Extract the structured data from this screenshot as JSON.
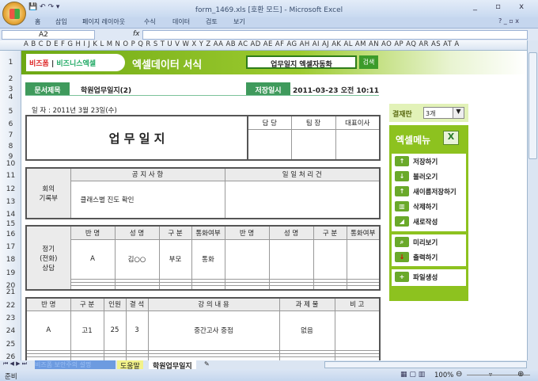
{
  "window": {
    "title": "form_1469.xls  [호환 모드] - Microsoft Excel",
    "controls": "_ ▫ x"
  },
  "ribbon": {
    "tabs": [
      "홈",
      "삽입",
      "페이지 레이아웃",
      "수식",
      "데이터",
      "검토",
      "보기"
    ]
  },
  "formula_bar": {
    "name_box": "A2",
    "fx": "fx",
    "value": ""
  },
  "columns": "A B C D E F G H I J K L M N O P Q R S T U V W X Y Z AA AB AC AD AE AF AG AH AI AJ AK AL AM AN AO AP AQ AR AS AT A",
  "rows": [
    "1",
    "2",
    "3",
    "4",
    "5",
    "6",
    "7",
    "8",
    "9",
    "10",
    "11",
    "12",
    "13",
    "14",
    "15",
    "16",
    "17",
    "18",
    "19",
    "20",
    "21",
    "22",
    "23",
    "24",
    "25",
    "26"
  ],
  "banner": {
    "logo1": "비즈폼",
    "logo2": "비즈니스엑셀",
    "title": "엑셀데이터 서식",
    "search_value": "업무일지 엑셀자동화",
    "search_button": "검색"
  },
  "header": {
    "doc_title_label": "문서제목",
    "doc_title": "학원업무일지(2)",
    "saved_label": "저장일시",
    "saved_at": "2011-03-23  오전 10:11"
  },
  "date_line": "일 자 :   2011년 3월 23일(수)",
  "form": {
    "title": "업 무 일 지",
    "approvals": [
      "담 당",
      "팀 장",
      "대표이사"
    ],
    "meeting": {
      "label": "회의\n기록부",
      "notice_header": "공 지 사 항",
      "daily_header": "일 일 처 리 건",
      "notice": "클래스별 진도 확인",
      "daily": ""
    },
    "consult": {
      "label": "정기\n(전화)\n상담",
      "headers": [
        "반 명",
        "성 명",
        "구 분",
        "통화여부",
        "반 명",
        "성 명",
        "구 분",
        "통화여부"
      ],
      "rows": [
        [
          "A",
          "김○○",
          "부모",
          "통화",
          "",
          "",
          "",
          ""
        ],
        [
          "",
          "",
          "",
          "",
          "",
          "",
          "",
          ""
        ],
        [
          "",
          "",
          "",
          "",
          "",
          "",
          "",
          ""
        ],
        [
          "",
          "",
          "",
          "",
          "",
          "",
          "",
          ""
        ]
      ]
    },
    "lecture": {
      "headers": [
        "반 명",
        "구 분",
        "인원",
        "결 석",
        "강 의 내 용",
        "과 제 물",
        "비 고"
      ],
      "rows": [
        [
          "A",
          "고1",
          "25",
          "3",
          "중간고사 중점",
          "없음",
          ""
        ],
        [
          "",
          "",
          "",
          "",
          "",
          "",
          ""
        ],
        [
          "",
          "",
          "",
          "",
          "",
          "",
          ""
        ],
        [
          "",
          "",
          "",
          "",
          "",
          "",
          ""
        ]
      ]
    }
  },
  "panel": {
    "approval_label": "결재란",
    "approval_value": "3개",
    "menu_title": "엑셀메뉴",
    "group1": [
      "저장하기",
      "불러오기",
      "새이름저장하기",
      "삭제하기",
      "새로작성"
    ],
    "group2": [
      "미리보기",
      "출력하기"
    ],
    "group3": [
      "파일생성"
    ]
  },
  "sheet_tabs": [
    "비즈폼 보안주의 설명",
    "도움말",
    "학원업무일지"
  ],
  "status": {
    "ready": "준비",
    "zoom": "100%"
  }
}
